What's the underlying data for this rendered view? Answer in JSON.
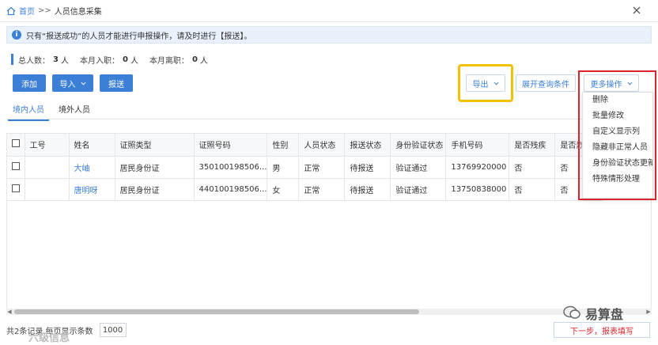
{
  "breadcrumb": {
    "home": "首页",
    "sep": ">>",
    "current": "人员信息采集"
  },
  "notice": {
    "text": "只有“报送成功”的人员才能进行申报操作，请及时进行【报送】。"
  },
  "stats": [
    {
      "label": "总人数：",
      "value": "3",
      "unit": "人"
    },
    {
      "label": "本月入职：",
      "value": "0",
      "unit": "人"
    },
    {
      "label": "本月离职：",
      "value": "0",
      "unit": "人"
    }
  ],
  "toolbar": {
    "add": "添加",
    "import": "导入",
    "submit": "报送",
    "export": "导出",
    "expand_query": "展开查询条件",
    "more_ops": "更多操作"
  },
  "tabs": [
    "境内人员",
    "境外人员"
  ],
  "table": {
    "headers": [
      "工号",
      "姓名",
      "证照类型",
      "证照号码",
      "性别",
      "人员状态",
      "报送状态",
      "身份验证状态",
      "手机号码",
      "是否残疾",
      "是否烈属"
    ],
    "rows": [
      [
        "",
        "大岫",
        "居民身份证",
        "350100198506...",
        "男",
        "正常",
        "待报送",
        "验证通过",
        "13769920000",
        "否",
        "否"
      ],
      [
        "",
        "唐明呀",
        "居民身份证",
        "440100198506...",
        "女",
        "正常",
        "待报送",
        "验证通过",
        "13750838000",
        "否",
        "否"
      ]
    ]
  },
  "more_menu": [
    "删除",
    "批量修改",
    "自定义显示列",
    "隐藏非正常人员",
    "身份验证状态更新",
    "特殊情形处理"
  ],
  "footer": {
    "label": "共2条记录 每页显示条数",
    "page_size": "1000",
    "next": "下一步，报表填写"
  },
  "watermark": {
    "left": "六级信息",
    "right": "易算盘"
  },
  "colors": {
    "accent": "#3b7fd6",
    "highlight_yellow": "#f2c100",
    "highlight_red": "#d9262c"
  }
}
